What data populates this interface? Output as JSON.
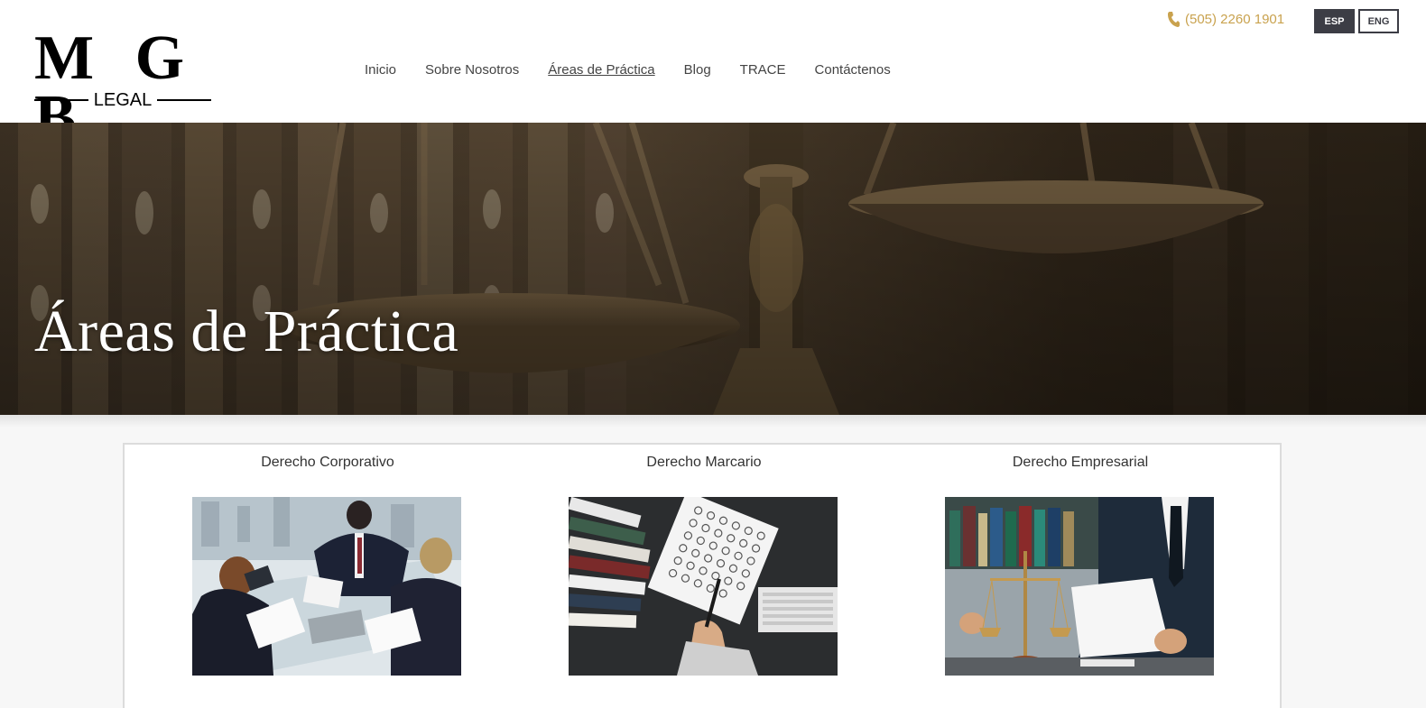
{
  "header": {
    "logo": {
      "main": "M G B",
      "sub": "LEGAL"
    },
    "nav": [
      {
        "label": "Inicio",
        "active": false
      },
      {
        "label": "Sobre Nosotros",
        "active": false
      },
      {
        "label": "Áreas de Práctica",
        "active": true
      },
      {
        "label": "Blog",
        "active": false
      },
      {
        "label": "TRACE",
        "active": false
      },
      {
        "label": "Contáctenos",
        "active": false
      }
    ],
    "phone": "(505) 2260 1901",
    "languages": {
      "esp": "ESP",
      "eng": "ENG"
    }
  },
  "hero": {
    "title": "Áreas de Práctica"
  },
  "areas": [
    {
      "title": "Derecho Corporativo",
      "image": "business-meeting"
    },
    {
      "title": "Derecho Marcario",
      "image": "trademark-documents"
    },
    {
      "title": "Derecho Empresarial",
      "image": "scales-of-justice-desk"
    }
  ],
  "colors": {
    "accent": "#c9a24e",
    "dark": "#3c3d45"
  }
}
